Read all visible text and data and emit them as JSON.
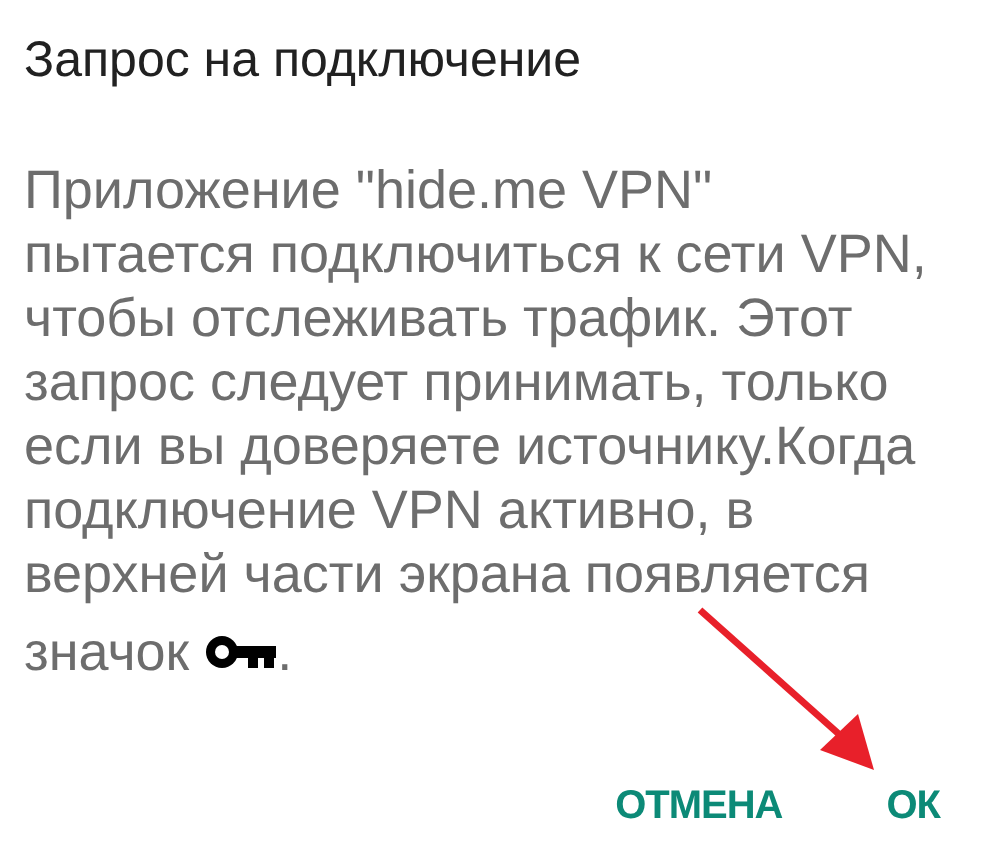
{
  "dialog": {
    "title": "Запрос на подключение",
    "message_lines": [
      "Приложение \"hide.me VPN\"",
      "пытается подключиться к сети VPN,",
      "чтобы отслеживать трафик. Этот",
      "запрос следует принимать, только",
      "если вы доверяете источнику.Когда",
      "подключение VPN активно, в",
      "верхней части экрана появляется"
    ],
    "message_end": "значок",
    "message_tail": ".",
    "buttons": [
      {
        "label": "ОТМЕНА"
      },
      {
        "label": "ОК"
      }
    ]
  }
}
